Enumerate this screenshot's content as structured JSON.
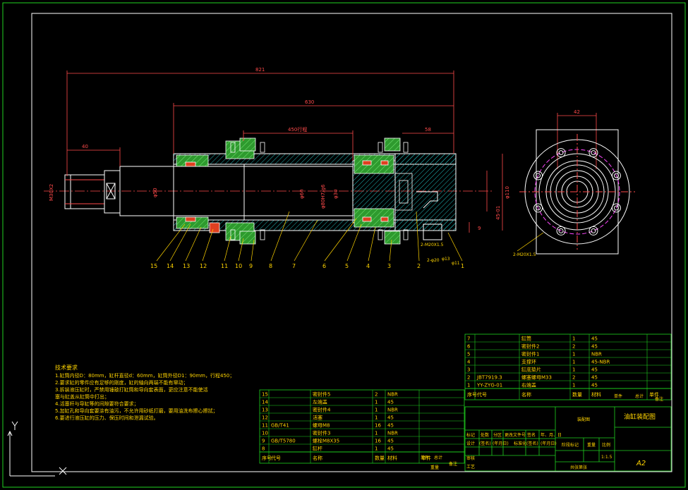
{
  "drawing": {
    "title": "油缸装配图",
    "sheet_size": "A2",
    "scale": "1:1.5",
    "unit_label": "装配图"
  },
  "dimensions": {
    "overall": "821",
    "body": "630",
    "stroke": "450行程",
    "left_ext": "40",
    "right_ext": "58",
    "flange_width": "42",
    "thread_left": "M30X2",
    "rod_dia": "φ50",
    "bore_dia": "φ80H7/g6",
    "inner_dia": "φ60",
    "piston_dia": "φ30",
    "outer_dia": "φ110",
    "port_size": "45-01",
    "small_dim": "9",
    "port_note_1": "2-M20X1.5",
    "port_note_2": "2-φ20",
    "port_note_3": "φ13",
    "port_note_4": "φ11",
    "end_view_note": "2-M20X1.5"
  },
  "balloons": [
    "15",
    "14",
    "13",
    "12",
    "11",
    "10",
    "9",
    "8",
    "7",
    "6",
    "5",
    "4",
    "3",
    "2",
    "1"
  ],
  "notes": {
    "heading": "技术要求",
    "lines": [
      "1.缸筒内径D：80mm，缸杆直径d：60mm，缸筒外径D1：90mm，行程450；",
      "2.要求缸的零件应有足够的刚度，缸的轴向两端不能有窜动；",
      "3.拆装液压缸时，严禁用锤敲打缸筒和导向套表面，更应注意不能使活",
      "  塞与缸盖从缸筒中打出；",
      "4.活塞杆与导缸等的间隙要符合要求；",
      "5.加缸孔和导向套要涂有油污，不允许用砂纸打磨，要用油洗布擦心擦拭；",
      "6.要进行液压缸的压力、保压时间和泄漏试验。"
    ]
  },
  "bom_top": [
    {
      "no": "7",
      "code": "",
      "name": "缸筒",
      "qty": "1",
      "mat": "45"
    },
    {
      "no": "6",
      "code": "",
      "name": "密封件2",
      "qty": "2",
      "mat": "45"
    },
    {
      "no": "5",
      "code": "",
      "name": "密封件1",
      "qty": "1",
      "mat": "NBR"
    },
    {
      "no": "4",
      "code": "",
      "name": "支撑环",
      "qty": "1",
      "mat": "45-NBR"
    },
    {
      "no": "3",
      "code": "",
      "name": "缸底垫片",
      "qty": "1",
      "mat": "45"
    },
    {
      "no": "2",
      "code": "JBT7919.3",
      "name": "螺塞螺母M33",
      "qty": "2",
      "mat": "45"
    },
    {
      "no": "1",
      "code": "YY-ZYG-01",
      "name": "右端盖",
      "qty": "1",
      "mat": "45"
    }
  ],
  "bom_bottom": [
    {
      "no": "15",
      "code": "",
      "name": "密封件5",
      "qty": "2",
      "mat": "NBR"
    },
    {
      "no": "14",
      "code": "",
      "name": "左端盖",
      "qty": "1",
      "mat": "45"
    },
    {
      "no": "13",
      "code": "",
      "name": "密封件4",
      "qty": "1",
      "mat": "NBR"
    },
    {
      "no": "12",
      "code": "",
      "name": "活塞",
      "qty": "1",
      "mat": "45"
    },
    {
      "no": "11",
      "code": "GB/T41",
      "name": "螺母M8",
      "qty": "16",
      "mat": "45"
    },
    {
      "no": "10",
      "code": "",
      "name": "密封件3",
      "qty": "1",
      "mat": "NBR"
    },
    {
      "no": "9",
      "code": "GB/T5780",
      "name": "螺栓M8X35",
      "qty": "16",
      "mat": "45"
    },
    {
      "no": "8",
      "code": "",
      "name": "缸杆",
      "qty": "1",
      "mat": "45"
    }
  ],
  "headers": {
    "no": "序号",
    "code": "代号",
    "name": "名称",
    "qty": "数量",
    "mat": "材料",
    "unit_wt": "单件",
    "total_wt": "总计",
    "weight": "重量",
    "remark": "备注"
  },
  "title_block": {
    "rev_row1": [
      "标记",
      "处数",
      "分区",
      "更改文件号",
      "签名",
      "年、月、日"
    ],
    "rev_row2": [
      "设计",
      "(签名)",
      "(年月日)",
      "标准化(签名)",
      "(年月日)"
    ],
    "check_row": [
      "审核",
      "工艺"
    ],
    "stage_label": "阶段标记",
    "weight_label": "重量",
    "scale_label": "比例",
    "sheet_label": "共张第张"
  },
  "colors": {
    "outline": "#ffffff",
    "border": "#1fd21f",
    "dims": "#ff4a4a",
    "hatch": "#1fb9b9",
    "leader": "#ffd400",
    "text": "#ffd400",
    "bom": "#1fd21f",
    "bolt": "#ff48ff",
    "part_green": "#3ec83e",
    "seal_red": "#e04020"
  }
}
